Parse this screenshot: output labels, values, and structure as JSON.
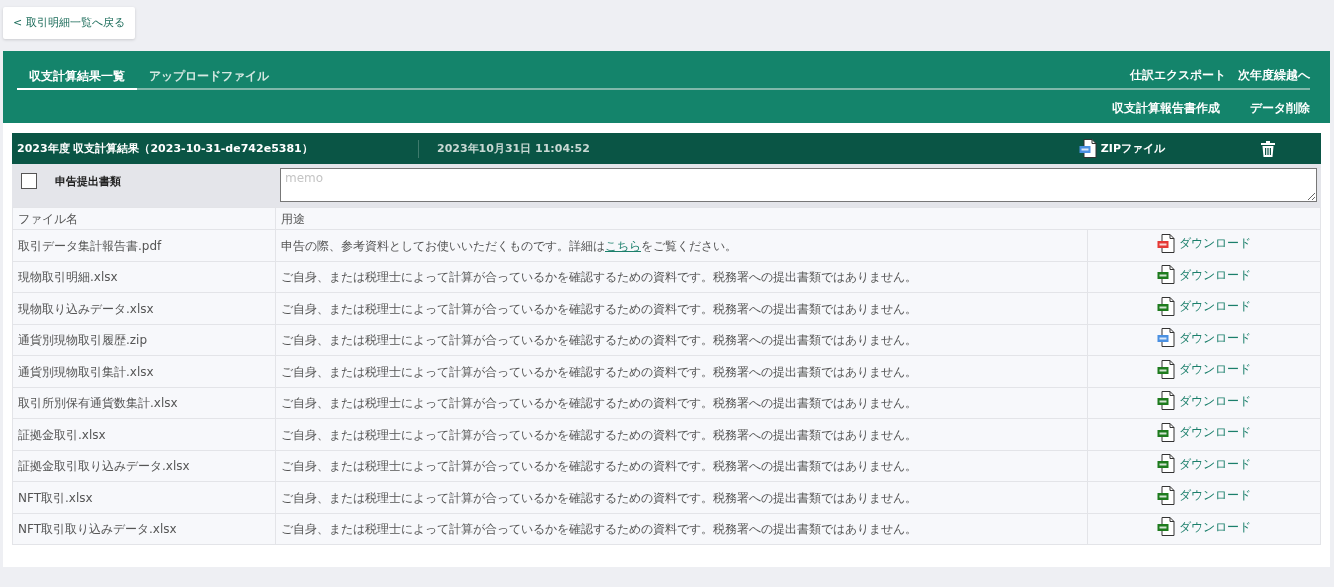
{
  "back_button": "< 取引明細一覧へ戻る",
  "tabs": [
    {
      "label": "収支計算結果一覧",
      "selected": true
    },
    {
      "label": "アップロードファイル",
      "selected": false
    }
  ],
  "top_actions": [
    "仕訳エクスポート",
    "次年度繰越へ"
  ],
  "sub_actions": [
    "収支計算報告書作成",
    "データ削除"
  ],
  "result": {
    "title": "2023年度 収支計算結果（2023-10-31-de742e5381）",
    "datetime": "2023年10月31日 11:04:52",
    "zip_label": "ZIPファイル",
    "submission": {
      "label": "申告提出書類",
      "checked": false
    },
    "memo": {
      "placeholder": "memo"
    }
  },
  "table": {
    "columns": [
      "ファイル名",
      "用途"
    ],
    "rows": [
      {
        "file": "取引データ集計報告書.pdf",
        "kind": "pdf",
        "description": [
          {
            "text": "申告の際、参考資料としてお使いいただくものです。詳細は"
          },
          {
            "text": "こちら",
            "kind": "link"
          },
          {
            "text": "をご覧ください。"
          }
        ],
        "action": "ダウンロード"
      },
      {
        "file": "現物取引明細.xlsx",
        "kind": "xls",
        "description": [
          {
            "text": "ご自身、または税理士によって計算が合っているかを確認するための資料です。税務署への提出書類ではありません。"
          }
        ],
        "action": "ダウンロード"
      },
      {
        "file": "現物取り込みデータ.xlsx",
        "kind": "xls",
        "description": [
          {
            "text": "ご自身、または税理士によって計算が合っているかを確認するための資料です。税務署への提出書類ではありません。"
          }
        ],
        "action": "ダウンロード"
      },
      {
        "file": "通貨別現物取引履歴.zip",
        "kind": "zip",
        "description": [
          {
            "text": "ご自身、または税理士によって計算が合っているかを確認するための資料です。税務署への提出書類ではありません。"
          }
        ],
        "action": "ダウンロード"
      },
      {
        "file": "通貨別現物取引集計.xlsx",
        "kind": "xls",
        "description": [
          {
            "text": "ご自身、または税理士によって計算が合っているかを確認するための資料です。税務署への提出書類ではありません。"
          }
        ],
        "action": "ダウンロード"
      },
      {
        "file": "取引所別保有通貨数集計.xlsx",
        "kind": "xls",
        "description": [
          {
            "text": "ご自身、または税理士によって計算が合っているかを確認するための資料です。税務署への提出書類ではありません。"
          }
        ],
        "action": "ダウンロード"
      },
      {
        "file": "証拠金取引.xlsx",
        "kind": "xls",
        "description": [
          {
            "text": "ご自身、または税理士によって計算が合っているかを確認するための資料です。税務署への提出書類ではありません。"
          }
        ],
        "action": "ダウンロード"
      },
      {
        "file": "証拠金取引取り込みデータ.xlsx",
        "kind": "xls",
        "description": [
          {
            "text": "ご自身、または税理士によって計算が合っているかを確認するための資料です。税務署への提出書類ではありません。"
          }
        ],
        "action": "ダウンロード"
      },
      {
        "file": "NFT取引.xlsx",
        "kind": "xls",
        "description": [
          {
            "text": "ご自身、または税理士によって計算が合っているかを確認するための資料です。税務署への提出書類ではありません。"
          }
        ],
        "action": "ダウンロード"
      },
      {
        "file": "NFT取引取り込みデータ.xlsx",
        "kind": "xls",
        "description": [
          {
            "text": "ご自身、または税理士によって計算が合っているかを確認するための資料です。税務署への提出書類ではありません。"
          }
        ],
        "action": "ダウンロード"
      }
    ]
  }
}
